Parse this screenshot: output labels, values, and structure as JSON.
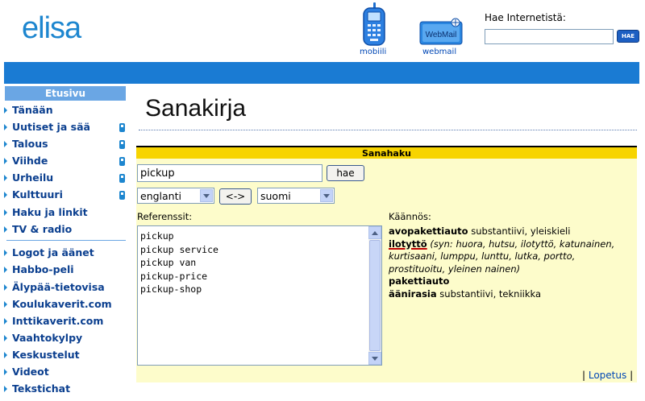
{
  "header": {
    "logo": "elisa",
    "mobiili_label": "mobiili",
    "webmail_label": "webmail",
    "webmail_icon_text": "WebMail",
    "search_title": "Hae Internetistä:",
    "search_value": "",
    "search_button": "HAE"
  },
  "sidebar": {
    "active": "Etusivu",
    "group1": [
      "Tänään",
      "Uutiset ja sää",
      "Talous",
      "Viihde",
      "Urheilu",
      "Kulttuuri",
      "Haku ja linkit",
      "TV & radio"
    ],
    "group2": [
      "Logot ja äänet",
      "Habbo-peli",
      "Älypää-tietovisa",
      "Koulukaverit.com",
      "Inttikaverit.com",
      "Vaahtokylpy",
      "Keskustelut",
      "Videot",
      "Tekstichat"
    ]
  },
  "main": {
    "title": "Sanakirja",
    "panel_header": "Sanahaku",
    "word_value": "pickup",
    "hae_button": "hae",
    "from_language": "englanti",
    "swap_button": "<->",
    "to_language": "suomi",
    "refs_label": "Referenssit:",
    "refs": [
      "pickup",
      "pickup service",
      "pickup van",
      "pickup-price",
      "pickup-shop"
    ],
    "trans_label": "Käännös:",
    "translations": {
      "t1_term": "avopakettiauto",
      "t1_info": " substantiivi, yleiskieli",
      "t2_term": "ilotyttö",
      "t2_syn": " (syn: huora, hutsu, ilotyttö, katunainen, kurtisaani, lumppu, lunttu, lutka, portto, prostituoitu, yleinen nainen)",
      "t3_term": "pakettiauto",
      "t4_term": "äänirasia",
      "t4_info": " substantiivi, tekniikka"
    },
    "footer_left": "| ",
    "lopetus": "Lopetus",
    "footer_right": " |"
  },
  "colors": {
    "brand_blue": "#1d86cf",
    "bar_blue": "#1a7bd3",
    "panel_yellow": "#fdfccb",
    "header_yellow": "#f7d400"
  }
}
